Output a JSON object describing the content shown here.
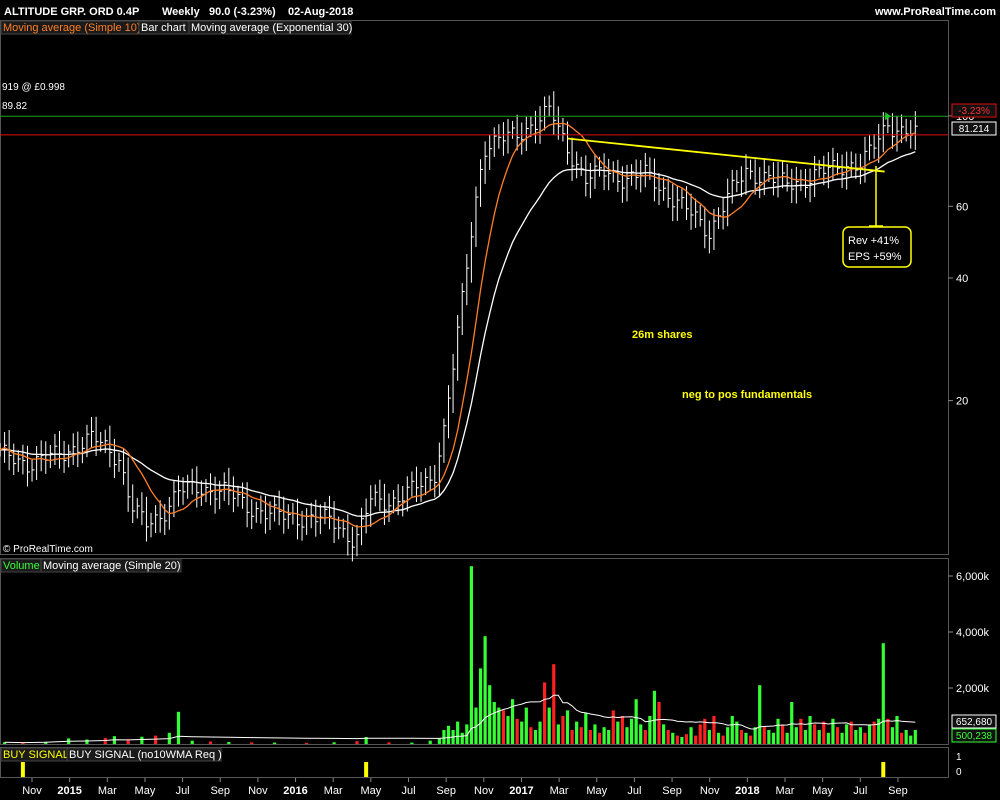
{
  "header": {
    "instrument": "ALTITUDE GRP. ORD 0.4P",
    "period": "Weekly",
    "quote": "90.0 (-3.23%)",
    "date": "02-Aug-2018",
    "brand": "www.ProRealTime.com"
  },
  "price_panel": {
    "legend": [
      {
        "label": "Moving average (Simple 10)",
        "color": "#ff7f27"
      },
      {
        "label": "Bar chart",
        "color": "#ffffff"
      },
      {
        "label": "Moving average (Exponential 30)",
        "color": "#ffffff"
      }
    ],
    "copyright": "© ProRealTime.com",
    "green_line_label": "919 @ £0.998",
    "red_line_label": "89.82",
    "red_tag": "-3.23%",
    "ema_tag": "81.214",
    "axis_ticks": [
      "100",
      "60",
      "40",
      "20"
    ],
    "annotations": {
      "shares": "26m shares",
      "fundamentals": "neg to pos fundamentals",
      "rev": "Rev +41%",
      "eps": "EPS +59%"
    }
  },
  "volume_panel": {
    "legend": [
      {
        "label": "Volume",
        "color": "#34ff34"
      },
      {
        "label": "Moving average (Simple 20)",
        "color": "#ffffff"
      }
    ],
    "axis_ticks": [
      "6,000k",
      "4,000k",
      "2,000k"
    ],
    "tag_ma": "652,680",
    "tag_vol": "500,238"
  },
  "signal_panel": {
    "legend": [
      {
        "label": "BUY SIGNAL",
        "color": "#ffff00"
      },
      {
        "label": "BUY SIGNAL (no10WMA Req )",
        "color": "#ffffff"
      }
    ],
    "axis_ticks": [
      "1",
      "0"
    ]
  },
  "x_axis": {
    "labels": [
      {
        "text": "Nov",
        "year": false
      },
      {
        "text": "2015",
        "year": true
      },
      {
        "text": "Mar",
        "year": false
      },
      {
        "text": "May",
        "year": false
      },
      {
        "text": "Jul",
        "year": false
      },
      {
        "text": "Sep",
        "year": false
      },
      {
        "text": "Nov",
        "year": false
      },
      {
        "text": "2016",
        "year": true
      },
      {
        "text": "Mar",
        "year": false
      },
      {
        "text": "May",
        "year": false
      },
      {
        "text": "Jul",
        "year": false
      },
      {
        "text": "Sep",
        "year": false
      },
      {
        "text": "Nov",
        "year": false
      },
      {
        "text": "2017",
        "year": true
      },
      {
        "text": "Mar",
        "year": false
      },
      {
        "text": "May",
        "year": false
      },
      {
        "text": "Jul",
        "year": false
      },
      {
        "text": "Sep",
        "year": false
      },
      {
        "text": "Nov",
        "year": false
      },
      {
        "text": "2018",
        "year": true
      },
      {
        "text": "Mar",
        "year": false
      },
      {
        "text": "May",
        "year": false
      },
      {
        "text": "Jul",
        "year": false
      },
      {
        "text": "Sep",
        "year": false
      }
    ]
  },
  "colors": {
    "background": "#000000",
    "panel_border": "#555555",
    "sma": "#ff7f27",
    "ema": "#ffffff",
    "bars": "#ffffff",
    "trendline": "#ffff00",
    "green_line": "#1f9d1f",
    "red_line": "#e01010",
    "vol_up": "#34ff34",
    "vol_down": "#ff2020",
    "signal": "#ffff00"
  },
  "chart_data": {
    "type": "bar",
    "scale": "log",
    "x_range": [
      "2014-10-01",
      "2018-09-20"
    ],
    "y_range": [
      8.5,
      170
    ],
    "price_levels": {
      "green_line": 99.8,
      "red_line": 89.82,
      "ema_last": 81.214
    },
    "trendline": [
      [
        "2017-02-15",
        88
      ],
      [
        "2018-06-15",
        73
      ]
    ],
    "anchors": [
      [
        "2014-10-01",
        14.8
      ],
      [
        "2014-11-15",
        14.0
      ],
      [
        "2015-01-10",
        15.0
      ],
      [
        "2015-02-20",
        16.2
      ],
      [
        "2015-04-01",
        14.5
      ],
      [
        "2015-04-20",
        11.0
      ],
      [
        "2015-05-12",
        9.9
      ],
      [
        "2015-06-05",
        10.5
      ],
      [
        "2015-07-01",
        12.0
      ],
      [
        "2015-08-01",
        12.2
      ],
      [
        "2015-09-10",
        12.0
      ],
      [
        "2015-10-15",
        11.0
      ],
      [
        "2015-11-20",
        10.5
      ],
      [
        "2016-01-10",
        10.3
      ],
      [
        "2016-02-20",
        10.2
      ],
      [
        "2016-03-28",
        9.0
      ],
      [
        "2016-04-20",
        11.4
      ],
      [
        "2016-05-20",
        11.3
      ],
      [
        "2016-06-20",
        12.0
      ],
      [
        "2016-07-25",
        12.9
      ],
      [
        "2016-08-10",
        17.0
      ],
      [
        "2016-08-25",
        25.0
      ],
      [
        "2016-09-10",
        38.0
      ],
      [
        "2016-09-25",
        58.0
      ],
      [
        "2016-10-10",
        84.0
      ],
      [
        "2016-11-01",
        87.0
      ],
      [
        "2016-12-01",
        90.0
      ],
      [
        "2016-12-25",
        96.0
      ],
      [
        "2017-01-20",
        103.0
      ],
      [
        "2017-02-10",
        86.0
      ],
      [
        "2017-03-15",
        70.0
      ],
      [
        "2017-04-15",
        73.0
      ],
      [
        "2017-05-15",
        70.0
      ],
      [
        "2017-06-15",
        72.0
      ],
      [
        "2017-07-20",
        64.0
      ],
      [
        "2017-08-20",
        58.0
      ],
      [
        "2017-09-20",
        52.0
      ],
      [
        "2017-10-20",
        64.0
      ],
      [
        "2017-11-15",
        73.0
      ],
      [
        "2017-12-15",
        71.0
      ],
      [
        "2018-01-15",
        68.0
      ],
      [
        "2018-02-15",
        70.0
      ],
      [
        "2018-03-15",
        73.0
      ],
      [
        "2018-04-15",
        76.0
      ],
      [
        "2018-05-10",
        76.0
      ],
      [
        "2018-06-01",
        85.0
      ],
      [
        "2018-06-20",
        96.0
      ],
      [
        "2018-07-10",
        92.0
      ],
      [
        "2018-08-02",
        90.0
      ]
    ],
    "volume": {
      "y_range_k": [
        0,
        6500
      ],
      "bars": [
        [
          "2014-10-08",
          60,
          "g"
        ],
        [
          "2014-11-05",
          40,
          "r"
        ],
        [
          "2014-12-10",
          80,
          "g"
        ],
        [
          "2015-01-14",
          200,
          "g"
        ],
        [
          "2015-02-11",
          160,
          "g"
        ],
        [
          "2015-03-11",
          220,
          "r"
        ],
        [
          "2015-03-25",
          280,
          "g"
        ],
        [
          "2015-04-15",
          140,
          "r"
        ],
        [
          "2015-05-06",
          260,
          "g"
        ],
        [
          "2015-05-27",
          300,
          "r"
        ],
        [
          "2015-06-17",
          400,
          "g"
        ],
        [
          "2015-07-01",
          1150,
          "g"
        ],
        [
          "2015-07-22",
          120,
          "g"
        ],
        [
          "2015-08-19",
          90,
          "r"
        ],
        [
          "2015-09-16",
          70,
          "g"
        ],
        [
          "2015-10-21",
          60,
          "r"
        ],
        [
          "2015-11-25",
          50,
          "g"
        ],
        [
          "2016-01-13",
          40,
          "r"
        ],
        [
          "2016-02-24",
          60,
          "g"
        ],
        [
          "2016-03-30",
          100,
          "r"
        ],
        [
          "2016-04-13",
          250,
          "g"
        ],
        [
          "2016-05-18",
          60,
          "r"
        ],
        [
          "2016-06-22",
          50,
          "g"
        ],
        [
          "2016-07-20",
          120,
          "g"
        ],
        [
          "2016-08-03",
          200,
          "g"
        ],
        [
          "2016-08-10",
          500,
          "g"
        ],
        [
          "2016-08-17",
          650,
          "g"
        ],
        [
          "2016-08-24",
          500,
          "g"
        ],
        [
          "2016-08-31",
          800,
          "g"
        ],
        [
          "2016-09-07",
          400,
          "g"
        ],
        [
          "2016-09-14",
          700,
          "g"
        ],
        [
          "2016-09-21",
          6350,
          "g"
        ],
        [
          "2016-09-28",
          1300,
          "g"
        ],
        [
          "2016-10-05",
          2700,
          "g"
        ],
        [
          "2016-10-12",
          3850,
          "g"
        ],
        [
          "2016-10-19",
          2100,
          "g"
        ],
        [
          "2016-10-26",
          1500,
          "g"
        ],
        [
          "2016-11-02",
          1300,
          "g"
        ],
        [
          "2016-11-09",
          1200,
          "r"
        ],
        [
          "2016-11-16",
          1000,
          "g"
        ],
        [
          "2016-11-23",
          1600,
          "g"
        ],
        [
          "2016-11-30",
          900,
          "r"
        ],
        [
          "2016-12-07",
          800,
          "g"
        ],
        [
          "2016-12-14",
          1300,
          "g"
        ],
        [
          "2016-12-21",
          600,
          "r"
        ],
        [
          "2016-12-28",
          500,
          "g"
        ],
        [
          "2017-01-04",
          800,
          "g"
        ],
        [
          "2017-01-11",
          2200,
          "r"
        ],
        [
          "2017-01-18",
          1300,
          "g"
        ],
        [
          "2017-01-25",
          2850,
          "r"
        ],
        [
          "2017-02-01",
          700,
          "g"
        ],
        [
          "2017-02-08",
          1000,
          "r"
        ],
        [
          "2017-02-15",
          1200,
          "g"
        ],
        [
          "2017-02-22",
          500,
          "r"
        ],
        [
          "2017-03-01",
          800,
          "g"
        ],
        [
          "2017-03-08",
          600,
          "r"
        ],
        [
          "2017-03-15",
          1100,
          "g"
        ],
        [
          "2017-03-22",
          500,
          "r"
        ],
        [
          "2017-03-29",
          700,
          "g"
        ],
        [
          "2017-04-05",
          400,
          "r"
        ],
        [
          "2017-04-12",
          600,
          "g"
        ],
        [
          "2017-04-19",
          500,
          "g"
        ],
        [
          "2017-04-26",
          1200,
          "r"
        ],
        [
          "2017-05-03",
          800,
          "g"
        ],
        [
          "2017-05-10",
          1000,
          "r"
        ],
        [
          "2017-05-17",
          600,
          "g"
        ],
        [
          "2017-05-24",
          900,
          "g"
        ],
        [
          "2017-05-31",
          1600,
          "g"
        ],
        [
          "2017-06-07",
          700,
          "g"
        ],
        [
          "2017-06-14",
          500,
          "r"
        ],
        [
          "2017-06-21",
          1000,
          "g"
        ],
        [
          "2017-06-28",
          1900,
          "g"
        ],
        [
          "2017-07-05",
          1500,
          "r"
        ],
        [
          "2017-07-12",
          700,
          "g"
        ],
        [
          "2017-07-19",
          500,
          "r"
        ],
        [
          "2017-07-26",
          400,
          "g"
        ],
        [
          "2017-08-02",
          300,
          "r"
        ],
        [
          "2017-08-09",
          250,
          "g"
        ],
        [
          "2017-08-16",
          350,
          "r"
        ],
        [
          "2017-08-23",
          600,
          "g"
        ],
        [
          "2017-08-30",
          300,
          "r"
        ],
        [
          "2017-09-06",
          700,
          "r"
        ],
        [
          "2017-09-13",
          900,
          "r"
        ],
        [
          "2017-09-20",
          500,
          "g"
        ],
        [
          "2017-09-27",
          1000,
          "r"
        ],
        [
          "2017-10-04",
          400,
          "g"
        ],
        [
          "2017-10-11",
          300,
          "r"
        ],
        [
          "2017-10-18",
          600,
          "g"
        ],
        [
          "2017-10-25",
          1000,
          "g"
        ],
        [
          "2017-11-01",
          800,
          "g"
        ],
        [
          "2017-11-08",
          500,
          "r"
        ],
        [
          "2017-11-15",
          400,
          "g"
        ],
        [
          "2017-11-22",
          300,
          "r"
        ],
        [
          "2017-11-29",
          600,
          "g"
        ],
        [
          "2017-12-06",
          2100,
          "g"
        ],
        [
          "2017-12-13",
          600,
          "r"
        ],
        [
          "2017-12-20",
          500,
          "g"
        ],
        [
          "2017-12-27",
          400,
          "g"
        ],
        [
          "2018-01-03",
          900,
          "g"
        ],
        [
          "2018-01-10",
          700,
          "r"
        ],
        [
          "2018-01-17",
          400,
          "g"
        ],
        [
          "2018-01-24",
          1500,
          "g"
        ],
        [
          "2018-01-31",
          600,
          "g"
        ],
        [
          "2018-02-07",
          900,
          "r"
        ],
        [
          "2018-02-14",
          500,
          "g"
        ],
        [
          "2018-02-21",
          1000,
          "g"
        ],
        [
          "2018-02-28",
          700,
          "r"
        ],
        [
          "2018-03-07",
          500,
          "g"
        ],
        [
          "2018-03-14",
          800,
          "r"
        ],
        [
          "2018-03-21",
          400,
          "g"
        ],
        [
          "2018-03-28",
          900,
          "g"
        ],
        [
          "2018-04-04",
          600,
          "r"
        ],
        [
          "2018-04-11",
          400,
          "g"
        ],
        [
          "2018-04-18",
          700,
          "g"
        ],
        [
          "2018-04-25",
          800,
          "r"
        ],
        [
          "2018-05-02",
          500,
          "g"
        ],
        [
          "2018-05-09",
          600,
          "g"
        ],
        [
          "2018-05-16",
          400,
          "r"
        ],
        [
          "2018-05-23",
          700,
          "g"
        ],
        [
          "2018-05-30",
          800,
          "r"
        ],
        [
          "2018-06-06",
          900,
          "g"
        ],
        [
          "2018-06-13",
          3600,
          "g"
        ],
        [
          "2018-06-20",
          900,
          "r"
        ],
        [
          "2018-06-27",
          600,
          "g"
        ],
        [
          "2018-07-04",
          1000,
          "g"
        ],
        [
          "2018-07-11",
          400,
          "r"
        ],
        [
          "2018-07-18",
          500,
          "g"
        ],
        [
          "2018-07-25",
          300,
          "g"
        ],
        [
          "2018-08-01",
          500,
          "g"
        ]
      ]
    },
    "buy_signals": [
      "2014-11-05",
      "2016-04-13",
      "2018-06-13"
    ]
  }
}
